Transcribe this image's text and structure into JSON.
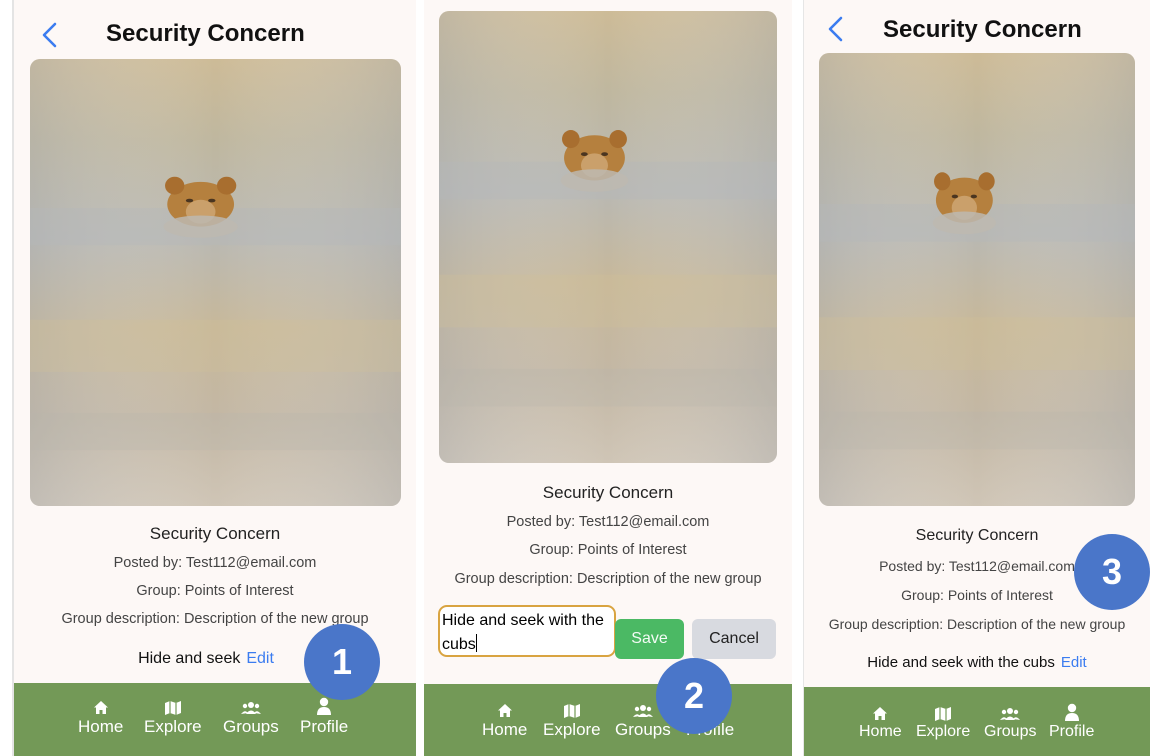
{
  "colors": {
    "accent": "#3b7cf0",
    "tabbar": "#739957",
    "badge": "#4a76c9",
    "save": "#4bb964",
    "cancel": "#d8dae0",
    "input_border": "#d9a441"
  },
  "panel1": {
    "header_title": "Security Concern",
    "post_title": "Security Concern",
    "posted_by": "Posted by: Test112@email.com",
    "group": "Group: Points of Interest",
    "group_description": "Group description: Description of the new group",
    "description": "Hide and seek",
    "edit_label": "Edit",
    "badge": "1"
  },
  "panel2": {
    "post_title": "Security Concern",
    "posted_by": "Posted by: Test112@email.com",
    "group": "Group: Points of Interest",
    "group_description": "Group description: Description of the new group",
    "input_line1": "Hide and seek with the",
    "input_line2": "cubs",
    "save_label": "Save",
    "cancel_label": "Cancel",
    "badge": "2"
  },
  "panel3": {
    "header_title": "Security Concern",
    "post_title": "Security Concern",
    "posted_by": "Posted by: Test112@email.com",
    "group": "Group: Points of Interest",
    "group_description": "Group description: Description of the new group",
    "description": "Hide and seek with the cubs",
    "edit_label": "Edit",
    "badge": "3"
  },
  "tabbar": {
    "items": [
      {
        "label": "Home",
        "icon": "home-icon"
      },
      {
        "label": "Explore",
        "icon": "map-icon"
      },
      {
        "label": "Groups",
        "icon": "groups-icon"
      },
      {
        "label": "Profile",
        "icon": "profile-icon"
      }
    ]
  }
}
